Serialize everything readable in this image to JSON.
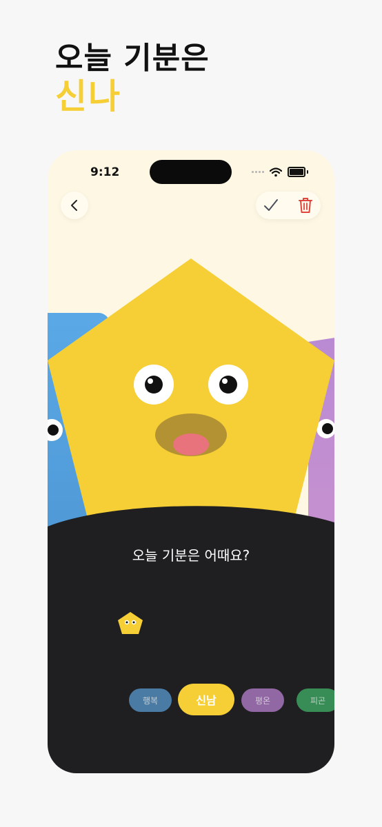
{
  "promo": {
    "line1": "오늘 기분은",
    "line2": "신나"
  },
  "status_bar": {
    "time": "9:12"
  },
  "header": {
    "back_icon": "chevron-left-icon",
    "confirm_icon": "check-icon",
    "delete_icon": "trash-icon"
  },
  "main": {
    "question": "오늘 기분은 어때요?",
    "character_shape": "pentagon",
    "character_color": "#f5cf35",
    "background_color": "#fdf7e3",
    "panel_color": "#1f1f21"
  },
  "moods": [
    {
      "label": "행복",
      "color": "#4f86b3"
    },
    {
      "label": "신남",
      "color": "#f5cf35",
      "selected": true
    },
    {
      "label": "평온",
      "color": "#9e6fb3"
    },
    {
      "label": "피곤",
      "color": "#3b9a5c"
    }
  ]
}
